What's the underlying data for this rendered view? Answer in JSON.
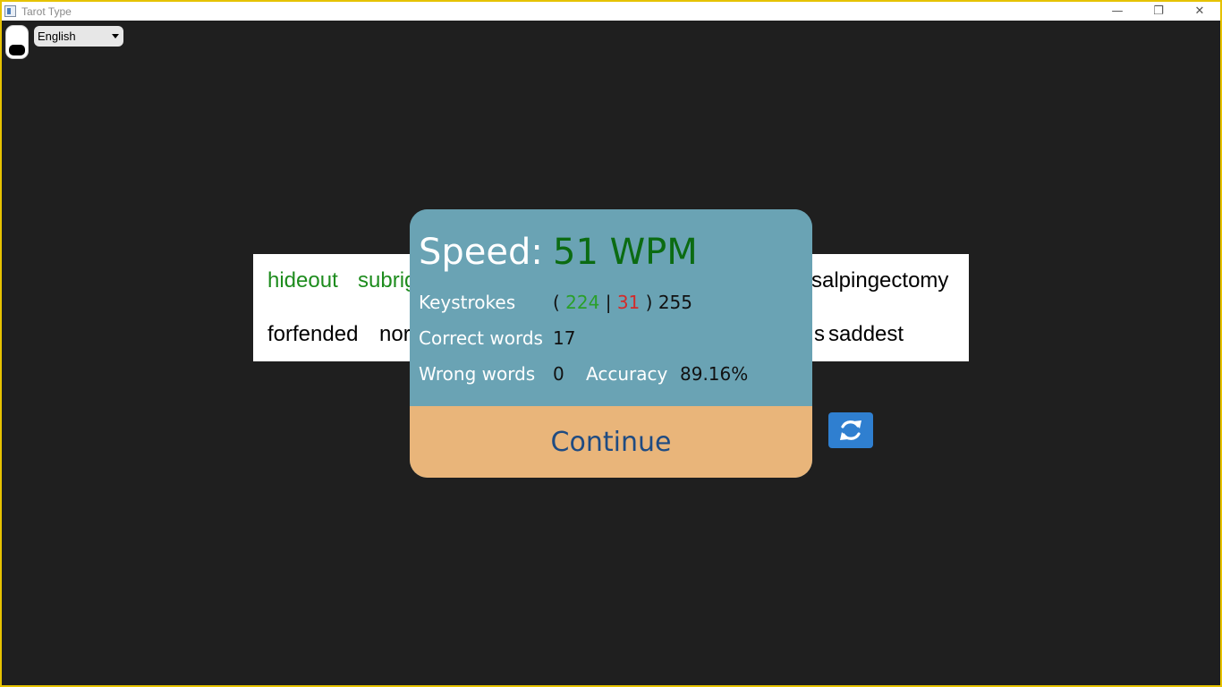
{
  "window": {
    "title": "Tarot Type",
    "controls": {
      "minimize": "—",
      "restore": "❐",
      "close": "✕"
    }
  },
  "toolbar": {
    "theme_toggle_icon": "theme-toggle-icon",
    "language": {
      "selected": "English"
    }
  },
  "typing_words": {
    "line1": [
      {
        "text": "hideout",
        "state": "correct"
      },
      {
        "text": "subrig",
        "state": "correct"
      },
      {
        "text": "salpingectomy",
        "state": "pending"
      }
    ],
    "line2": [
      {
        "text": "forfended",
        "state": "pending"
      },
      {
        "text": "nor",
        "state": "pending"
      },
      {
        "text": "s",
        "state": "pending"
      },
      {
        "text": "saddest",
        "state": "pending"
      }
    ]
  },
  "results": {
    "speed_label": "Speed:",
    "speed_value": "51 WPM",
    "keystrokes_label": "Keystrokes",
    "keystrokes": {
      "open_paren": "(",
      "correct": "224",
      "separator": "|",
      "wrong": "31",
      "close_paren": ")",
      "total": "255"
    },
    "correct_words_label": "Correct words",
    "correct_words_value": "17",
    "wrong_words_label": "Wrong words",
    "wrong_words_value": "0",
    "accuracy_label": "Accuracy",
    "accuracy_value": "89.16%",
    "continue_label": "Continue"
  },
  "restart_button": {
    "icon": "refresh-icon"
  },
  "colors": {
    "background": "#1f1f1f",
    "modal_stats": "#6aa3b4",
    "continue_bg": "#e9b57a",
    "continue_text": "#1f4b82",
    "speed_value": "#0b6b12",
    "correct_word": "#1e8c1e",
    "keystroke_correct": "#2aa02a",
    "keystroke_wrong": "#d42a2a",
    "restart_button": "#2f7fd0",
    "window_border": "#e6c200"
  }
}
